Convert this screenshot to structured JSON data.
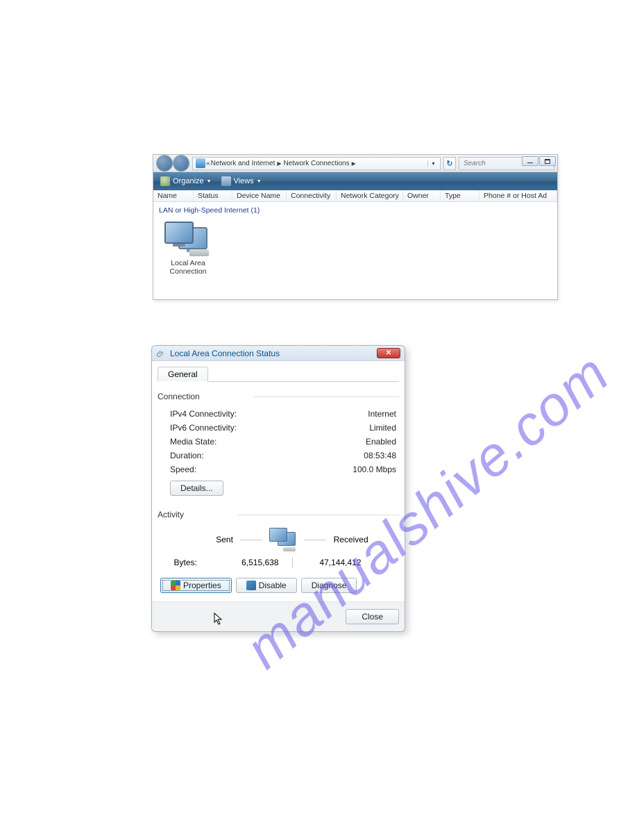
{
  "watermark": "manualshive.com",
  "explorer": {
    "breadcrumb_root": "«",
    "breadcrumb_1": "Network and Internet",
    "breadcrumb_2": "Network Connections",
    "search_placeholder": "Search",
    "toolbar": {
      "organize": "Organize",
      "views": "Views"
    },
    "columns": {
      "name": "Name",
      "status": "Status",
      "device": "Device Name",
      "connectivity": "Connectivity",
      "category": "Network Category",
      "owner": "Owner",
      "type": "Type",
      "phone": "Phone # or Host Ad"
    },
    "group_header": "LAN or High-Speed Internet (1)",
    "item_label_1": "Local Area",
    "item_label_2": "Connection"
  },
  "dialog": {
    "title": "Local Area Connection Status",
    "tab_general": "General",
    "section_connection": "Connection",
    "ipv4_label": "IPv4 Connectivity:",
    "ipv4_value": "Internet",
    "ipv6_label": "IPv6 Connectivity:",
    "ipv6_value": "Limited",
    "media_label": "Media State:",
    "media_value": "Enabled",
    "duration_label": "Duration:",
    "duration_value": "08:53:48",
    "speed_label": "Speed:",
    "speed_value": "100.0 Mbps",
    "details_btn": "Details...",
    "section_activity": "Activity",
    "sent_label": "Sent",
    "received_label": "Received",
    "bytes_label": "Bytes:",
    "bytes_sent": "6,515,638",
    "bytes_recv": "47,144,412",
    "properties_btn": "Properties",
    "disable_btn": "Disable",
    "diagnose_btn": "Diagnose",
    "close_btn": "Close"
  }
}
